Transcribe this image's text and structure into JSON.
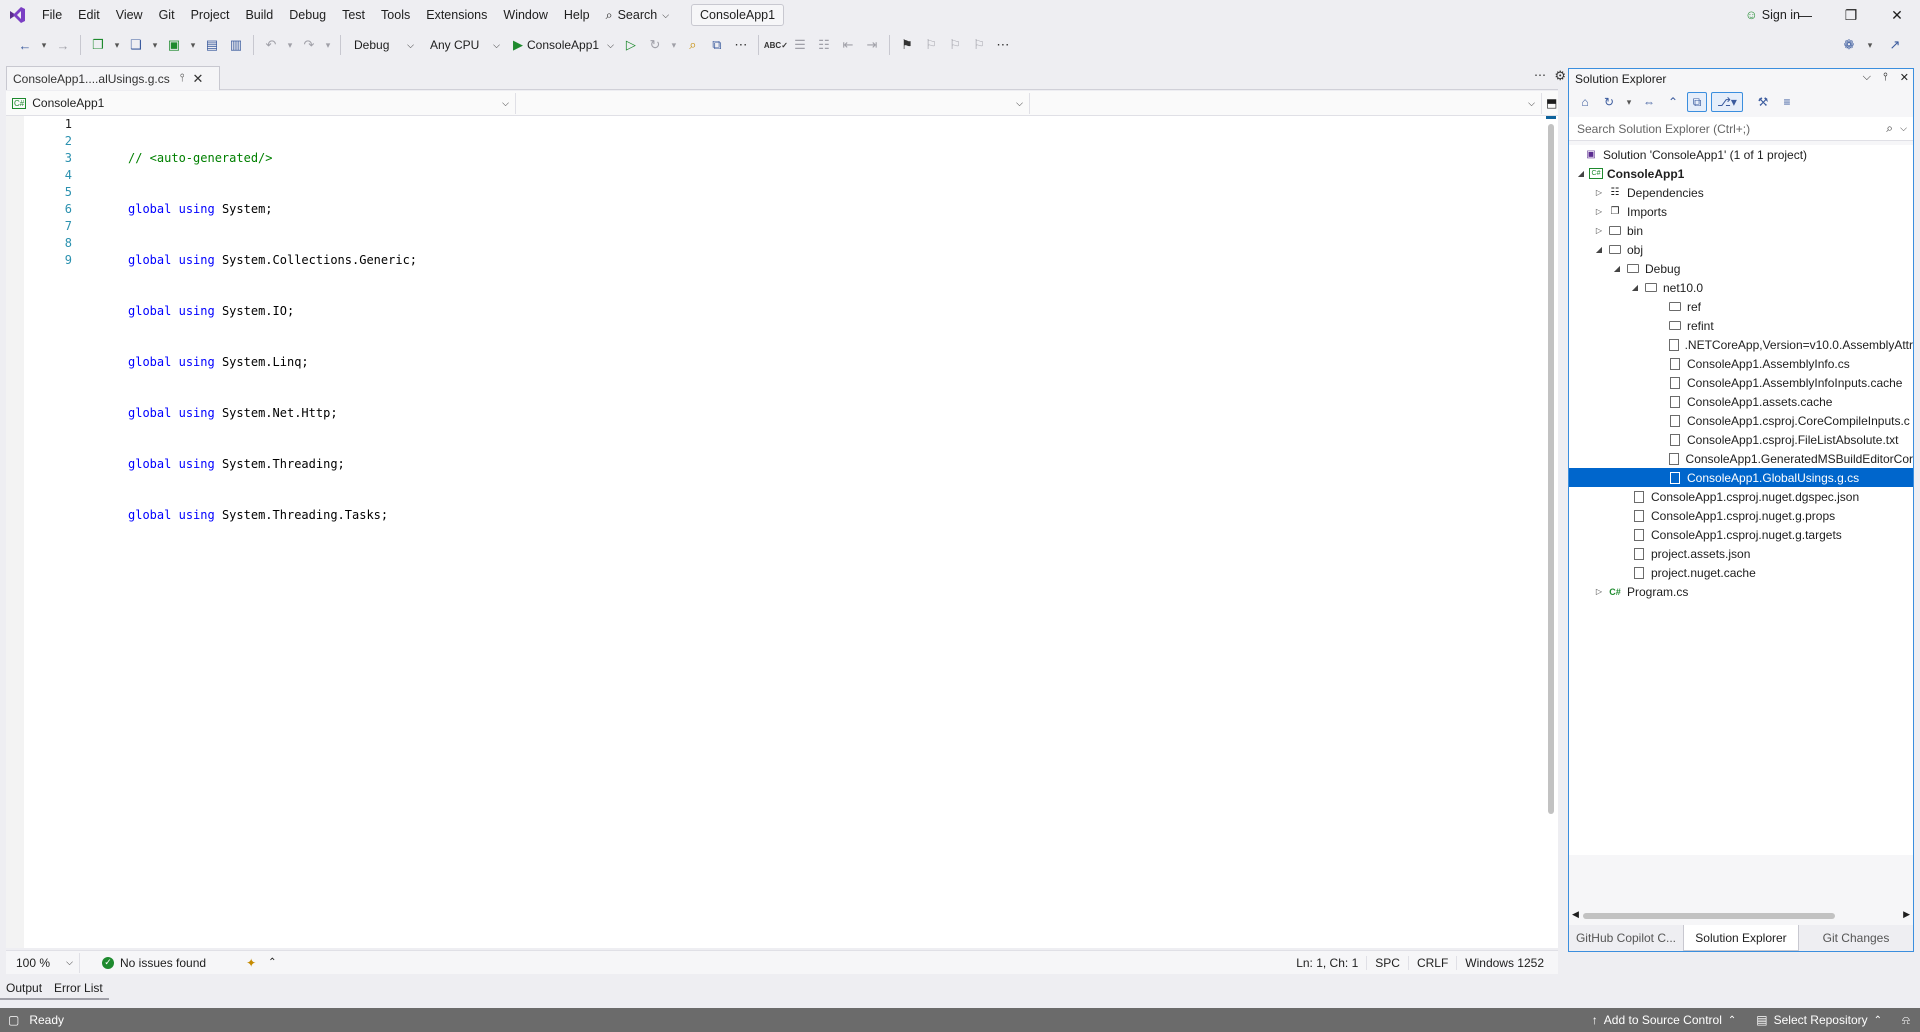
{
  "titlebar": {
    "menus": [
      "File",
      "Edit",
      "View",
      "Git",
      "Project",
      "Build",
      "Debug",
      "Test",
      "Tools",
      "Extensions",
      "Window",
      "Help"
    ],
    "search_label": "Search",
    "solution_name": "ConsoleApp1",
    "sign_in": "Sign in"
  },
  "toolbar": {
    "configuration": "Debug",
    "platform": "Any CPU",
    "startup_project": "ConsoleApp1"
  },
  "editor": {
    "tab_title": "ConsoleApp1....alUsings.g.cs",
    "nav_project": "ConsoleApp1",
    "line_numbers": [
      "1",
      "2",
      "3",
      "4",
      "5",
      "6",
      "7",
      "8",
      "9"
    ],
    "comment": "// <auto-generated/>",
    "keywords": [
      "global",
      "using"
    ],
    "usings": [
      "System;",
      "System.Collections.Generic;",
      "System.IO;",
      "System.Linq;",
      "System.Net.Http;",
      "System.Threading;",
      "System.Threading.Tasks;"
    ],
    "zoom": "100 %",
    "issues": "No issues found",
    "position": "Ln: 1, Ch: 1",
    "whitespace": "SPC",
    "line_endings": "CRLF",
    "encoding": "Windows 1252"
  },
  "bottom_tabs": [
    "Output",
    "Error List"
  ],
  "solution_explorer": {
    "title": "Solution Explorer",
    "search_placeholder": "Search Solution Explorer (Ctrl+;)",
    "tree": [
      {
        "label": "Solution 'ConsoleApp1' (1 of 1 project)",
        "icon": "solution-icon"
      },
      {
        "label": "ConsoleApp1",
        "icon": "csharp-project-icon",
        "bold": true
      },
      {
        "label": "Dependencies",
        "icon": "dependencies-icon"
      },
      {
        "label": "Imports",
        "icon": "imports-icon"
      },
      {
        "label": "bin",
        "icon": "folder-icon"
      },
      {
        "label": "obj",
        "icon": "folder-icon"
      },
      {
        "label": "Debug",
        "icon": "folder-icon"
      },
      {
        "label": "net10.0",
        "icon": "folder-icon"
      },
      {
        "label": "ref",
        "icon": "folder-icon"
      },
      {
        "label": "refint",
        "icon": "folder-icon"
      },
      {
        "label": ".NETCoreApp,Version=v10.0.AssemblyAttr",
        "icon": "file-icon"
      },
      {
        "label": "ConsoleApp1.AssemblyInfo.cs",
        "icon": "file-icon"
      },
      {
        "label": "ConsoleApp1.AssemblyInfoInputs.cache",
        "icon": "file-icon"
      },
      {
        "label": "ConsoleApp1.assets.cache",
        "icon": "file-icon"
      },
      {
        "label": "ConsoleApp1.csproj.CoreCompileInputs.c",
        "icon": "file-icon"
      },
      {
        "label": "ConsoleApp1.csproj.FileListAbsolute.txt",
        "icon": "file-icon"
      },
      {
        "label": "ConsoleApp1.GeneratedMSBuildEditorCor",
        "icon": "file-icon"
      },
      {
        "label": "ConsoleApp1.GlobalUsings.g.cs",
        "icon": "file-icon",
        "selected": true
      },
      {
        "label": "ConsoleApp1.csproj.nuget.dgspec.json",
        "icon": "file-icon"
      },
      {
        "label": "ConsoleApp1.csproj.nuget.g.props",
        "icon": "file-icon"
      },
      {
        "label": "ConsoleApp1.csproj.nuget.g.targets",
        "icon": "file-icon"
      },
      {
        "label": "project.assets.json",
        "icon": "file-icon"
      },
      {
        "label": "project.nuget.cache",
        "icon": "file-icon"
      },
      {
        "label": "Program.cs",
        "icon": "csharp-file-icon"
      }
    ],
    "tabs": [
      "GitHub Copilot C...",
      "Solution Explorer",
      "Git Changes"
    ]
  },
  "statusbar": {
    "ready": "Ready",
    "source_control": "Add to Source Control",
    "repository": "Select Repository"
  },
  "colors": {
    "accent": "#0066cc",
    "keyword": "#0000ff",
    "comment": "#008000",
    "line_number": "#2b91af",
    "statusbar": "#6b6b6b"
  }
}
